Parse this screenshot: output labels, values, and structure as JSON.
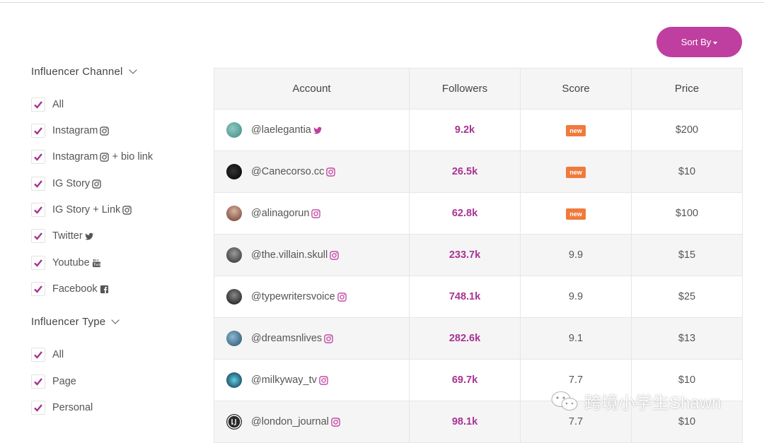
{
  "sort_button": {
    "label": "Sort By"
  },
  "sidebar": {
    "channel_heading": "Influencer Channel",
    "channels": [
      {
        "label": "All",
        "icon": "",
        "checked": true
      },
      {
        "label": "Instagram",
        "icon": "instagram-icon",
        "checked": true
      },
      {
        "label": "Instagram",
        "suffix": "+ bio link",
        "icon": "instagram-icon",
        "checked": true
      },
      {
        "label": "IG Story",
        "icon": "instagram-icon",
        "checked": true
      },
      {
        "label": "IG Story + Link",
        "icon": "instagram-icon",
        "checked": true
      },
      {
        "label": "Twitter",
        "icon": "twitter-icon",
        "checked": true
      },
      {
        "label": "Youtube",
        "icon": "youtube-icon",
        "checked": true
      },
      {
        "label": "Facebook",
        "icon": "facebook-icon",
        "checked": true
      }
    ],
    "type_heading": "Influencer Type",
    "types": [
      {
        "label": "All",
        "checked": true
      },
      {
        "label": "Page",
        "checked": true
      },
      {
        "label": "Personal",
        "checked": true
      }
    ]
  },
  "table": {
    "headers": [
      "Account",
      "Followers",
      "Score",
      "Price"
    ],
    "rows": [
      {
        "handle": "@laelegantia",
        "icon": "twitter-icon",
        "followers": "9.2k",
        "score": "new",
        "is_new": true,
        "price": "$200"
      },
      {
        "handle": "@Canecorso.cc",
        "icon": "instagram-icon",
        "followers": "26.5k",
        "score": "new",
        "is_new": true,
        "price": "$10"
      },
      {
        "handle": "@alinagorun",
        "icon": "instagram-icon",
        "followers": "62.8k",
        "score": "new",
        "is_new": true,
        "price": "$100"
      },
      {
        "handle": "@the.villain.skull",
        "icon": "instagram-icon",
        "followers": "233.7k",
        "score": "9.9",
        "is_new": false,
        "price": "$15"
      },
      {
        "handle": "@typewritersvoice",
        "icon": "instagram-icon",
        "followers": "748.1k",
        "score": "9.9",
        "is_new": false,
        "price": "$25"
      },
      {
        "handle": "@dreamsnlives",
        "icon": "instagram-icon",
        "followers": "282.6k",
        "score": "9.1",
        "is_new": false,
        "price": "$13"
      },
      {
        "handle": "@milkyway_tv",
        "icon": "instagram-icon",
        "followers": "69.7k",
        "score": "7.7",
        "is_new": false,
        "price": "$10"
      },
      {
        "handle": "@london_journal",
        "icon": "instagram-icon",
        "followers": "98.1k",
        "score": "7.7",
        "is_new": false,
        "price": "$10"
      }
    ]
  },
  "watermark": {
    "text": "跨境小学生Shawn"
  },
  "colors": {
    "accent": "#bf3fa0",
    "followers": "#a83293",
    "new_badge": "#f07a3c"
  }
}
